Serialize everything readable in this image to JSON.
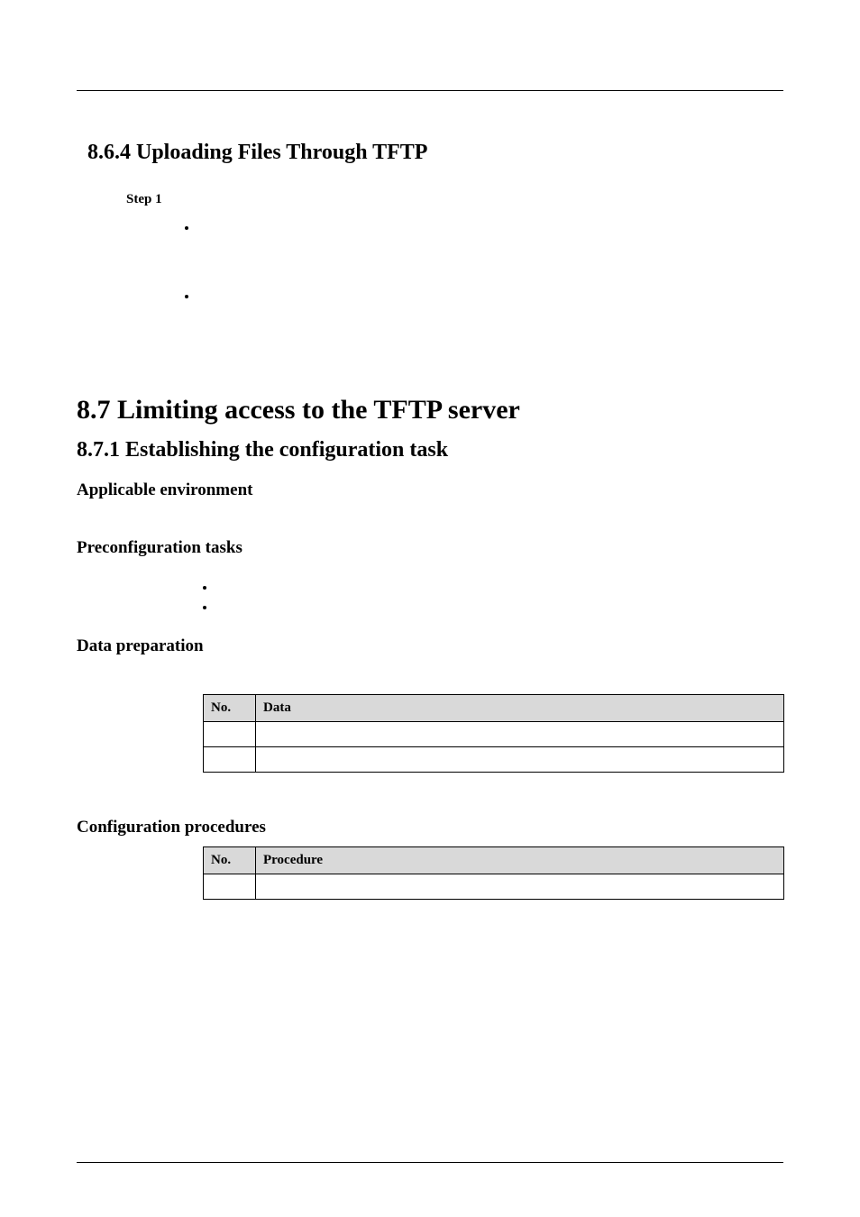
{
  "section_864": {
    "heading": "8.6.4 Uploading Files Through TFTP",
    "step_label": "Step 1",
    "bullets": [
      "",
      ""
    ]
  },
  "section_87": {
    "heading": "8.7 Limiting access to the TFTP server"
  },
  "section_871": {
    "heading": "8.7.1 Establishing the configuration task",
    "applicable_env_label": "Applicable environment",
    "preconfig_label": "Preconfiguration tasks",
    "preconfig_bullets": [
      "",
      ""
    ],
    "data_prep_label": "Data preparation",
    "data_table": {
      "headers": {
        "no": "No.",
        "data": "Data"
      },
      "rows": [
        {
          "no": "",
          "data": ""
        },
        {
          "no": "",
          "data": ""
        }
      ]
    },
    "config_proc_label": "Configuration procedures",
    "proc_table": {
      "headers": {
        "no": "No.",
        "procedure": "Procedure"
      },
      "rows": [
        {
          "no": "",
          "procedure": ""
        }
      ]
    }
  }
}
